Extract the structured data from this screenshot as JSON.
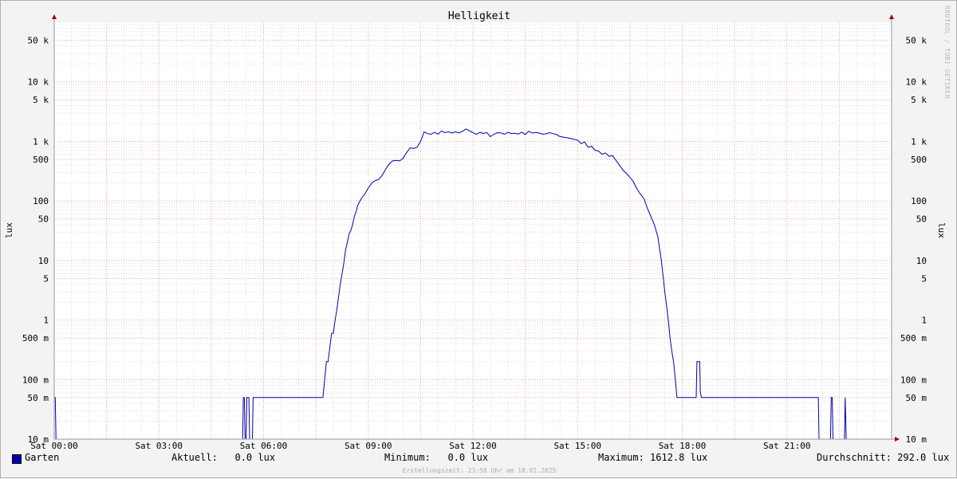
{
  "chart_data": {
    "type": "line",
    "title": "Helligkeit",
    "ylabel": "lux",
    "yscale": "log",
    "ylim": [
      0.01,
      100000
    ],
    "xlim_hours": [
      0,
      24
    ],
    "x_ticks": [
      {
        "hour": 0,
        "label": "Sat 00:00"
      },
      {
        "hour": 3,
        "label": "Sat 03:00"
      },
      {
        "hour": 6,
        "label": "Sat 06:00"
      },
      {
        "hour": 9,
        "label": "Sat 09:00"
      },
      {
        "hour": 12,
        "label": "Sat 12:00"
      },
      {
        "hour": 15,
        "label": "Sat 15:00"
      },
      {
        "hour": 18,
        "label": "Sat 18:00"
      },
      {
        "hour": 21,
        "label": "Sat 21:00"
      }
    ],
    "y_ticks": [
      {
        "value": 50000,
        "label": "50 k"
      },
      {
        "value": 10000,
        "label": "10 k"
      },
      {
        "value": 5000,
        "label": "5 k"
      },
      {
        "value": 1000,
        "label": "1 k"
      },
      {
        "value": 500,
        "label": "500"
      },
      {
        "value": 100,
        "label": "100"
      },
      {
        "value": 50,
        "label": "50"
      },
      {
        "value": 10,
        "label": "10"
      },
      {
        "value": 5,
        "label": "5"
      },
      {
        "value": 1,
        "label": "1"
      },
      {
        "value": 0.5,
        "label": "500 m"
      },
      {
        "value": 0.1,
        "label": "100 m"
      },
      {
        "value": 0.05,
        "label": "50 m"
      },
      {
        "value": 0.01,
        "label": "10 m"
      }
    ],
    "series": [
      {
        "name": "Garten",
        "color": "#0000aa",
        "points": [
          [
            0.0,
            0.05
          ],
          [
            0.03,
            0.05
          ],
          [
            0.05,
            0.01
          ],
          [
            5.4,
            0.01
          ],
          [
            5.42,
            0.05
          ],
          [
            5.45,
            0.05
          ],
          [
            5.47,
            0.01
          ],
          [
            5.5,
            0.01
          ],
          [
            5.52,
            0.05
          ],
          [
            5.58,
            0.05
          ],
          [
            5.6,
            0.01
          ],
          [
            5.68,
            0.01
          ],
          [
            5.7,
            0.05
          ],
          [
            7.7,
            0.05
          ],
          [
            7.75,
            0.1
          ],
          [
            7.8,
            0.2
          ],
          [
            7.85,
            0.2
          ],
          [
            7.9,
            0.35
          ],
          [
            7.95,
            0.6
          ],
          [
            8.0,
            0.6
          ],
          [
            8.05,
            1.0
          ],
          [
            8.1,
            1.5
          ],
          [
            8.15,
            2.5
          ],
          [
            8.2,
            4
          ],
          [
            8.25,
            6
          ],
          [
            8.3,
            9
          ],
          [
            8.35,
            15
          ],
          [
            8.4,
            20
          ],
          [
            8.45,
            28
          ],
          [
            8.5,
            32
          ],
          [
            8.55,
            40
          ],
          [
            8.6,
            55
          ],
          [
            8.65,
            65
          ],
          [
            8.7,
            85
          ],
          [
            8.8,
            110
          ],
          [
            8.9,
            130
          ],
          [
            9.0,
            165
          ],
          [
            9.1,
            200
          ],
          [
            9.2,
            220
          ],
          [
            9.3,
            230
          ],
          [
            9.4,
            270
          ],
          [
            9.5,
            340
          ],
          [
            9.6,
            420
          ],
          [
            9.7,
            470
          ],
          [
            9.8,
            480
          ],
          [
            9.9,
            470
          ],
          [
            10.0,
            520
          ],
          [
            10.1,
            650
          ],
          [
            10.2,
            780
          ],
          [
            10.3,
            760
          ],
          [
            10.4,
            800
          ],
          [
            10.5,
            1000
          ],
          [
            10.6,
            1450
          ],
          [
            10.7,
            1350
          ],
          [
            10.8,
            1320
          ],
          [
            10.9,
            1420
          ],
          [
            11.0,
            1320
          ],
          [
            11.1,
            1500
          ],
          [
            11.2,
            1400
          ],
          [
            11.3,
            1450
          ],
          [
            11.4,
            1380
          ],
          [
            11.5,
            1450
          ],
          [
            11.6,
            1390
          ],
          [
            11.7,
            1480
          ],
          [
            11.8,
            1620
          ],
          [
            11.9,
            1510
          ],
          [
            12.0,
            1400
          ],
          [
            12.1,
            1320
          ],
          [
            12.2,
            1420
          ],
          [
            12.3,
            1360
          ],
          [
            12.4,
            1410
          ],
          [
            12.5,
            1200
          ],
          [
            12.6,
            1320
          ],
          [
            12.7,
            1400
          ],
          [
            12.8,
            1390
          ],
          [
            12.9,
            1320
          ],
          [
            13.0,
            1420
          ],
          [
            13.1,
            1360
          ],
          [
            13.2,
            1370
          ],
          [
            13.3,
            1330
          ],
          [
            13.4,
            1430
          ],
          [
            13.5,
            1310
          ],
          [
            13.6,
            1480
          ],
          [
            13.7,
            1380
          ],
          [
            13.8,
            1410
          ],
          [
            13.9,
            1380
          ],
          [
            14.0,
            1320
          ],
          [
            14.1,
            1340
          ],
          [
            14.2,
            1400
          ],
          [
            14.3,
            1350
          ],
          [
            14.4,
            1300
          ],
          [
            14.5,
            1200
          ],
          [
            14.6,
            1180
          ],
          [
            14.7,
            1150
          ],
          [
            14.8,
            1120
          ],
          [
            14.9,
            1080
          ],
          [
            15.0,
            1050
          ],
          [
            15.1,
            920
          ],
          [
            15.2,
            980
          ],
          [
            15.3,
            800
          ],
          [
            15.4,
            830
          ],
          [
            15.5,
            710
          ],
          [
            15.6,
            690
          ],
          [
            15.7,
            610
          ],
          [
            15.8,
            640
          ],
          [
            15.9,
            560
          ],
          [
            16.0,
            580
          ],
          [
            16.1,
            480
          ],
          [
            16.2,
            400
          ],
          [
            16.3,
            330
          ],
          [
            16.4,
            290
          ],
          [
            16.5,
            250
          ],
          [
            16.6,
            210
          ],
          [
            16.7,
            160
          ],
          [
            16.8,
            130
          ],
          [
            16.9,
            110
          ],
          [
            17.0,
            75
          ],
          [
            17.1,
            55
          ],
          [
            17.2,
            40
          ],
          [
            17.3,
            25
          ],
          [
            17.4,
            10
          ],
          [
            17.5,
            3
          ],
          [
            17.6,
            1
          ],
          [
            17.65,
            0.5
          ],
          [
            17.7,
            0.3
          ],
          [
            17.75,
            0.2
          ],
          [
            17.8,
            0.1
          ],
          [
            17.85,
            0.05
          ],
          [
            18.4,
            0.05
          ],
          [
            18.42,
            0.2
          ],
          [
            18.5,
            0.2
          ],
          [
            18.52,
            0.06
          ],
          [
            18.55,
            0.05
          ],
          [
            21.9,
            0.05
          ],
          [
            21.92,
            0.01
          ],
          [
            22.25,
            0.01
          ],
          [
            22.27,
            0.05
          ],
          [
            22.3,
            0.05
          ],
          [
            22.32,
            0.01
          ],
          [
            22.65,
            0.01
          ],
          [
            22.67,
            0.05
          ],
          [
            22.7,
            0.01
          ],
          [
            24.0,
            0.01
          ]
        ]
      }
    ]
  },
  "legend": {
    "series_name": "Garten",
    "aktuell": "Aktuell:   0.0 lux",
    "minimum": "Minimum:   0.0 lux",
    "maximum": "Maximum: 1612.8 lux",
    "durchschnitt": "Durchschnitt: 292.0 lux"
  },
  "footer": "Erstellungszeit: 23:58 Uhr am 18.01.2025",
  "watermark": "RRDTOOL / TOBI OETIKER"
}
